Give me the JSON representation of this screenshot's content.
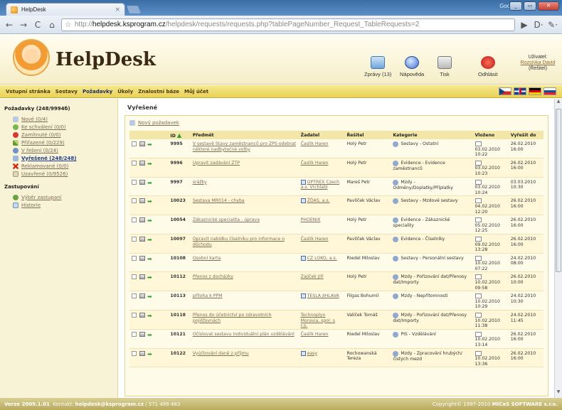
{
  "browser": {
    "tab_title": "HelpDesk",
    "tab_close": "×",
    "google_label": "Google",
    "url_scheme": "http://",
    "url_host": "helpdesk.ksprogram.cz",
    "url_rest": "/helpdesk/requests/requests.php?tablePageNumber_Request_TableRequests=2",
    "nav": {
      "back": "←",
      "forward": "→",
      "reload": "C",
      "home": "⌂",
      "star": "☆",
      "go": "▶",
      "page": "D·",
      "tools": "✎·"
    }
  },
  "header": {
    "logo_text": "HelpDesk",
    "tools": [
      {
        "name": "messages",
        "label": "Zprávy (13)"
      },
      {
        "name": "help",
        "label": "Nápověda"
      },
      {
        "name": "print",
        "label": "Tisk"
      },
      {
        "name": "logout",
        "label": "Odhlásit"
      }
    ],
    "user_label": "Uživatel:",
    "user_name": "Rozsívka David",
    "user_role": "(Řešitel)"
  },
  "menu": [
    "Vstupní stránka",
    "Sestavy",
    "Požadavky",
    "Úkoly",
    "Znalostní báze",
    "Můj účet"
  ],
  "menu_active": "Požadavky",
  "sidebar": {
    "title": "Požadavky (248/9994б)",
    "items": [
      {
        "label": "Nové (0/4)",
        "icon": "new-icon"
      },
      {
        "label": "Ke schválení (0/0)",
        "icon": "pending-icon"
      },
      {
        "label": "Zamítnuté (0/0)",
        "icon": "rejected-icon"
      },
      {
        "label": "Přiřazené (0/229)",
        "icon": "assigned-icon"
      },
      {
        "label": "V řešení (0/24)",
        "icon": "solving-icon"
      },
      {
        "label": "Vyřešené (248/248)",
        "icon": "solved-icon"
      },
      {
        "label": "Reklamované (0/0)",
        "icon": "claim-icon"
      },
      {
        "label": "Uzavřené (0/9526)",
        "icon": "closed-icon"
      }
    ],
    "section2": "Zastupování",
    "items2": [
      {
        "label": "Výběr zastupaní",
        "icon": "proxy-icon"
      },
      {
        "label": "Historie",
        "icon": "history-icon"
      }
    ]
  },
  "main": {
    "title": "Vyřešené",
    "new_request": "Nový požadavek",
    "columns": [
      "ID",
      "Předmět",
      "Žadatel",
      "Řešitel",
      "Kategorie",
      "Vloženo",
      "Vyřešit do"
    ],
    "rows": [
      {
        "id": "9995",
        "subject": "V sestavě Stavy zaměstnanců pro ZPS odebrat některé nadbytečné volby",
        "requester": "Časlík Haren",
        "party": false,
        "solver": "Holý Petr",
        "category": "Sestavy - Ostatní",
        "created": "03.02.2010 10:22",
        "due": "26.02.2010 16:00"
      },
      {
        "id": "9996",
        "subject": "Upravit zadávání ZTP",
        "requester": "Časlík Haren",
        "party": false,
        "solver": "Holý Petr",
        "category": "Evidence - Evidence zaměstnanců",
        "created": "03.02.2010 10:23",
        "due": "26.02.2010 16:00"
      },
      {
        "id": "9997",
        "subject": "srážky",
        "requester": "OPTREX Czech a.s. Vrchlabí",
        "party": true,
        "solver": "Mareš Petr",
        "category": "Mzdy - Odměny/Doplatky/Příplatky",
        "created": "03.02.2010 10:24",
        "due": "03.03.2010 10:30"
      },
      {
        "id": "10023",
        "subject": "Sestava MR014 - chyba",
        "requester": "ŽĎAS, a.s.",
        "party": true,
        "solver": "Pavlíček Václav",
        "category": "Sestavy - Mzdové sestavy",
        "created": "04.02.2010 12:20",
        "due": "26.02.2010 16:00"
      },
      {
        "id": "10054",
        "subject": "Zákaznické specialita - úprava",
        "requester": "PHOENIX",
        "party": false,
        "solver": "Holý Petr",
        "category": "Evidence - Zákaznické speciality",
        "created": "05.02.2010 12:25",
        "due": "26.02.2010 16:00"
      },
      {
        "id": "10097",
        "subject": "Opravit nabídku číselníku pro informace o důchodu",
        "requester": "Časlík Haren",
        "party": false,
        "solver": "Pavlíček Václav",
        "category": "Evidence - Číselníky",
        "created": "09.02.2010 13:28",
        "due": "26.02.2010 16:00"
      },
      {
        "id": "10108",
        "subject": "Osobní karta",
        "requester": "CZ LOKO, a.s.",
        "party": true,
        "solver": "Riedel Miloslav",
        "category": "Sestavy - Personální sestavy",
        "created": "10.02.2010 07:22",
        "due": "24.02.2010 08:00"
      },
      {
        "id": "10112",
        "subject": "Přenos z docházky",
        "requester": "Zajíček Jiří",
        "party": false,
        "solver": "Holý Petr",
        "category": "Mzdy - Pořizování dat/Přenosy dat/Importy",
        "created": "10.02.2010 09:58",
        "due": "26.02.2010 10:00"
      },
      {
        "id": "10113",
        "subject": "příloha k PPM",
        "requester": "TESLA JIHLAVA",
        "party": true,
        "solver": "Filgas Bohumil",
        "category": "Mzdy - Nepřítomnosti",
        "created": "10.02.2010 10:29",
        "due": "24.02.2010 10:30"
      },
      {
        "id": "10118",
        "subject": "Přenos do účetnictví po zdravotních pojišťovnách",
        "requester": "Technoplyn Moravia, spol. s r.o.",
        "party": false,
        "solver": "Valíček Tomáš",
        "category": "Mzdy - Pořizování dat/Přenosy dat/Importy",
        "created": "10.02.2010 11:38",
        "due": "24.02.2010 11:45"
      },
      {
        "id": "10121",
        "subject": "Očíslovat sestavu Individuální plán vzdělávání",
        "requester": "Časlík Haren",
        "party": false,
        "solver": "Riedel Miloslav",
        "category": "PIS - Vzdělávání",
        "created": "10.02.2010 13:14",
        "due": "26.02.2010 16:00"
      },
      {
        "id": "10122",
        "subject": "Vyúčtování daně z příjmu",
        "requester": "easy",
        "party": true,
        "solver": "Rochowanská Tereza",
        "category": "Mzdy - Zpracování hrubých/čistých mezd",
        "created": "10.02.2010 13:36",
        "due": "26.02.2010 16:00"
      }
    ]
  },
  "footer": {
    "version": "Verze 2009.1.01",
    "contact_label": "Kontakt:",
    "contact_email": "helpdesk@ksprogram.cz",
    "contact_phone": "/ 571 499 483",
    "copyright": "Copyright© 1997-2010",
    "company": "MICaS SOFTWARE s.r.o."
  }
}
